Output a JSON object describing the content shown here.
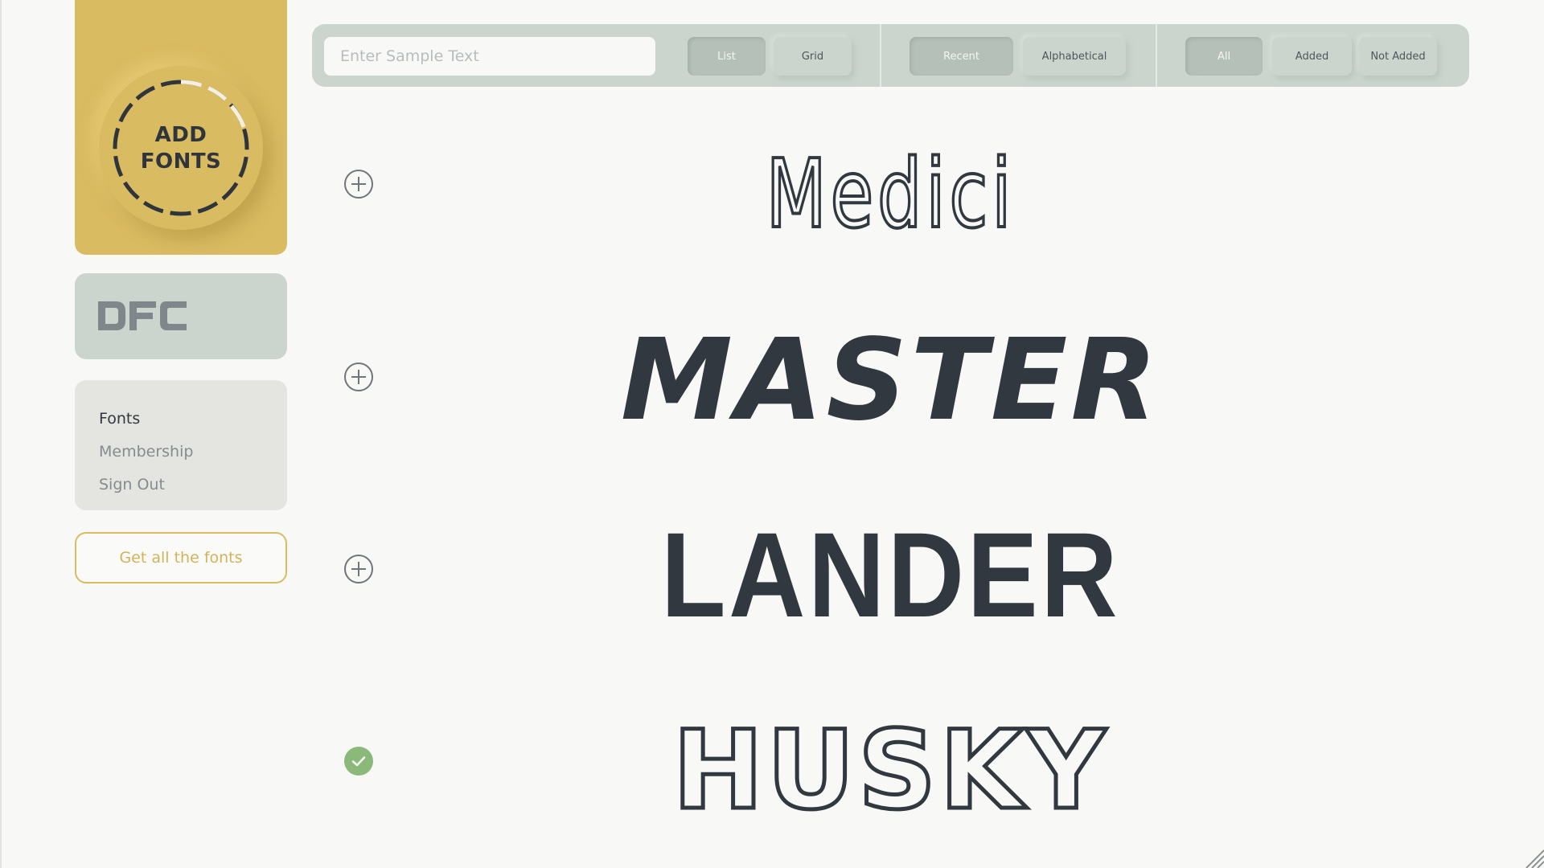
{
  "sidebar": {
    "add_fonts": {
      "line1": "ADD",
      "line2": "FONTS",
      "icon": "dashed-progress-ring"
    },
    "logo": {
      "text": "DFC"
    },
    "nav": [
      {
        "label": "Fonts",
        "active": true
      },
      {
        "label": "Membership",
        "active": false
      },
      {
        "label": "Sign Out",
        "active": false
      }
    ],
    "cta_label": "Get all the fonts"
  },
  "toolbar": {
    "search": {
      "placeholder": "Enter Sample Text",
      "value": ""
    },
    "view": {
      "options": [
        "List",
        "Grid"
      ],
      "selected": "List"
    },
    "sort": {
      "options": [
        "Recent",
        "Alphabetical"
      ],
      "selected": "Recent"
    },
    "filter": {
      "options": [
        "All",
        "Added",
        "Not Added"
      ],
      "selected": "All"
    }
  },
  "fonts": [
    {
      "name": "Medici",
      "preview": "Medici",
      "added": false,
      "icon": "plus-circle-icon"
    },
    {
      "name": "Master",
      "preview": "MASTER",
      "added": false,
      "icon": "plus-circle-icon"
    },
    {
      "name": "Lander",
      "preview": "LANDER",
      "added": false,
      "icon": "plus-circle-icon"
    },
    {
      "name": "Husky",
      "preview": "HUSKY",
      "added": true,
      "icon": "check-circle-icon"
    }
  ],
  "colors": {
    "accent_gold": "#d9bb62",
    "panel_sage": "#cbd5ce",
    "text_dark": "#313840",
    "added_green": "#8bb97a"
  }
}
